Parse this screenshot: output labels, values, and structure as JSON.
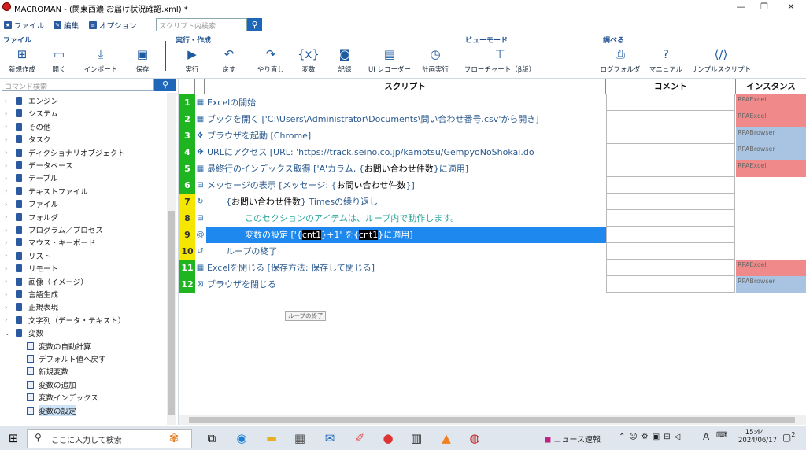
{
  "window": {
    "title": "MACROMAN - (関東西濃 お届け状況確認.xml) *",
    "min": "—",
    "max": "❐",
    "close": "✕"
  },
  "menu": {
    "file": "ファイル",
    "edit": "編集",
    "options": "オプション",
    "search_placeholder": "スクリプト内検索"
  },
  "ribbon": {
    "groups": {
      "file": "ファイル",
      "run": "実行・作成",
      "view": "ビューモード",
      "look": "調べる"
    },
    "buttons": {
      "new": "新規作成",
      "open": "開く",
      "import": "インポート",
      "save": "保存",
      "run": "実行",
      "undo": "戻す",
      "redo": "やり直し",
      "variable": "変数",
      "record": "記録",
      "ui_recorder": "UI レコーダー",
      "schedule": "計画実行",
      "flowchart": "フローチャート（β版）",
      "log_folder": "ログフォルダ",
      "manual": "マニュアル",
      "sample": "サンプルスクリプト"
    }
  },
  "sidebar": {
    "search_placeholder": "コマンド検索",
    "categories": [
      "エンジン",
      "システム",
      "その他",
      "タスク",
      "ディクショナリオブジェクト",
      "データベース",
      "テーブル",
      "テキストファイル",
      "ファイル",
      "フォルダ",
      "プログラム／プロセス",
      "マウス・キーボード",
      "リスト",
      "リモート",
      "画像（イメージ）",
      "言語生成",
      "正規表現",
      "文字列（データ・テキスト）",
      "変数"
    ],
    "children": [
      "変数の自動計算",
      "デフォルト値へ戻す",
      "新規変数",
      "変数の追加",
      "変数インデックス",
      "変数の設定"
    ]
  },
  "grid": {
    "headers": {
      "script": "スクリプト",
      "comment": "コメント",
      "instance": "インスタンス"
    },
    "rows": [
      {
        "num": "1",
        "icon": "table-icon",
        "text": "Excelの開始",
        "instance": "RPAExcel"
      },
      {
        "num": "2",
        "icon": "table-icon",
        "text": "ブックを開く ['C:\\Users\\Administrator\\Documents\\問い合わせ番号.csv'から開き]",
        "instance": "RPAExcel"
      },
      {
        "num": "3",
        "icon": "browser-icon",
        "text": "ブラウザを起動 [Chrome]",
        "instance": "RPABrowser"
      },
      {
        "num": "4",
        "icon": "browser-icon",
        "text": "URLにアクセス [URL: 'https://track.seino.co.jp/kamotsu/GempyoNoShokai.do",
        "instance": "RPABrowser"
      },
      {
        "num": "5",
        "icon": "table-icon",
        "text_a": "最終行のインデックス取得 ['A'カラム, {",
        "text_hl": "お問い合わせ件数",
        "text_b": "}に適用]",
        "instance": "RPAExcel"
      },
      {
        "num": "6",
        "icon": "collapse-icon",
        "text_a": "メッセージの表示 [メッセージ: {",
        "text_hl": "お問い合わせ件数",
        "text_b": "}]",
        "instance": ""
      },
      {
        "num": "7",
        "icon": "loop-icon",
        "text_a": "{",
        "text_hl": "お問い合わせ件数",
        "text_b": "} Timesの繰り返し",
        "instance": ""
      },
      {
        "num": "8",
        "icon": "collapse-icon",
        "text": "このセクションのアイテムは、ループ内で動作します。",
        "instance": ""
      },
      {
        "num": "9",
        "icon": "variable-icon",
        "text_a": "変数の設定 ['{",
        "text_hl": "cnt1",
        "text_m": "}+1' を{",
        "text_hl2": "cnt1",
        "text_b": "}に適用]",
        "instance": ""
      },
      {
        "num": "10",
        "icon": "loop-end-icon",
        "text": "ループの終了",
        "instance": ""
      },
      {
        "num": "11",
        "icon": "table-icon",
        "text": "Excelを閉じる [保存方法: 保存して閉じる]",
        "instance": "RPAExcel"
      },
      {
        "num": "12",
        "icon": "close-browser-icon",
        "text": "ブラウザを閉じる",
        "instance": "RPABrowser"
      }
    ],
    "tooltip": "ループの終了"
  },
  "taskbar": {
    "search": "ここに入力して検索",
    "news": "ニュース速報",
    "ime": "A",
    "time": "15:44",
    "date": "2024/06/17",
    "notif": "2"
  },
  "colors": {
    "green": "#1fb520",
    "yellow": "#f5e600",
    "excel": "#f08a8a",
    "browser": "#a9c4e3",
    "selected": "#1e88ee",
    "accent": "#1d66b8"
  }
}
